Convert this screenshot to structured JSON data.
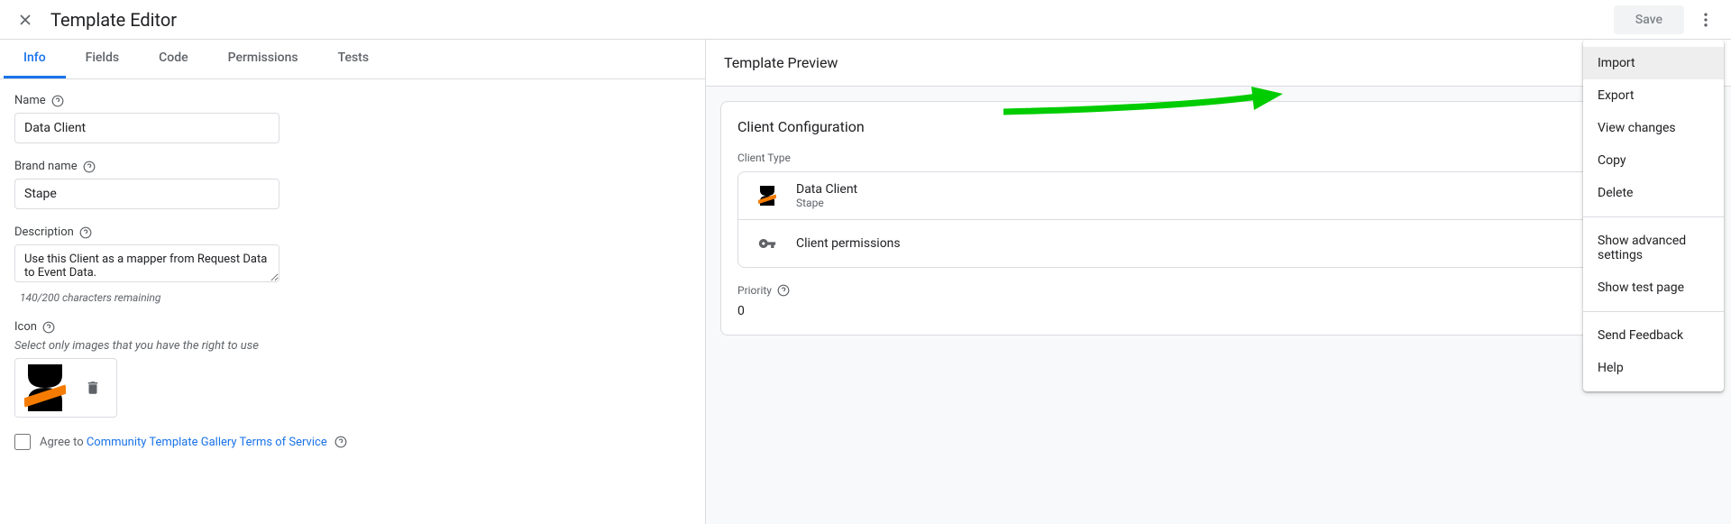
{
  "header": {
    "title": "Template Editor",
    "save_label": "Save"
  },
  "tabs": [
    "Info",
    "Fields",
    "Code",
    "Permissions",
    "Tests"
  ],
  "form": {
    "name_label": "Name",
    "name_value": "Data Client",
    "brand_label": "Brand name",
    "brand_value": "Stape",
    "desc_label": "Description",
    "desc_value": "Use this Client as a mapper from Request Data to Event Data.",
    "char_count": "140/200 characters remaining",
    "icon_label": "Icon",
    "icon_hint": "Select only images that you have the right to use",
    "tos_prefix": "Agree to ",
    "tos_link": "Community Template Gallery Terms of Service"
  },
  "preview": {
    "header": "Template Preview",
    "card_title": "Client Configuration",
    "client_type_label": "Client Type",
    "client_name": "Data Client",
    "client_brand": "Stape",
    "client_permissions": "Client permissions",
    "priority_label": "Priority",
    "priority_value": "0"
  },
  "menu": {
    "import": "Import",
    "export": "Export",
    "view_changes": "View changes",
    "copy": "Copy",
    "delete": "Delete",
    "show_advanced": "Show advanced settings",
    "show_test": "Show test page",
    "send_feedback": "Send Feedback",
    "help": "Help"
  }
}
